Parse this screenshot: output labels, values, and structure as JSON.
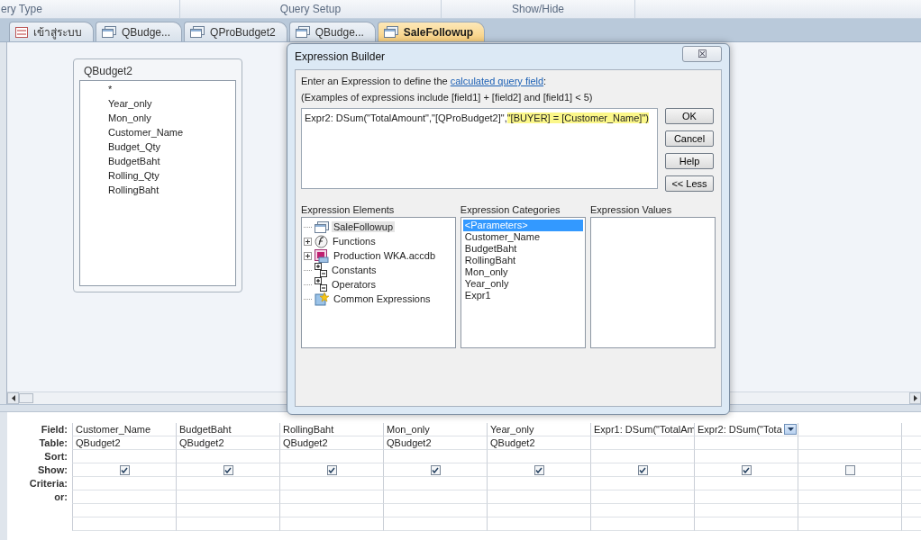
{
  "ribbon": {
    "groups": [
      "ery Type",
      "Query Setup",
      "Show/Hide"
    ]
  },
  "tabs": [
    {
      "label": "เข้าสู่ระบบ",
      "kind": "form",
      "selected": false
    },
    {
      "label": "QBudge...",
      "kind": "query",
      "selected": false
    },
    {
      "label": "QProBudget2",
      "kind": "query",
      "selected": false
    },
    {
      "label": "QBudge...",
      "kind": "query",
      "selected": false
    },
    {
      "label": "SaleFollowup",
      "kind": "query",
      "selected": true
    }
  ],
  "table_box": {
    "title": "QBudget2",
    "fields": [
      "*",
      "Year_only",
      "Mon_only",
      "Customer_Name",
      "Budget_Qty",
      "BudgetBaht",
      "Rolling_Qty",
      "RollingBaht"
    ]
  },
  "dialog": {
    "title": "Expression Builder",
    "close": "☒",
    "intro": "Enter an Expression to define the ",
    "link": "calculated query field",
    "intro_end": ":",
    "examples": "(Examples of expressions include [field1] + [field2] and [field1] < 5)",
    "expression": [
      {
        "text": "Expr2: DSum(\"TotalAmount\",\"[QProBudget2]\",",
        "highlighted": false
      },
      {
        "text": "\"[BUYER] = [Customer_Name]\")",
        "highlighted": true
      }
    ],
    "buttons": [
      "OK",
      "Cancel",
      "Help",
      "<< Less"
    ],
    "elements_label": "Expression Elements",
    "categories_label": "Expression Categories",
    "values_label": "Expression Values",
    "elements": [
      {
        "label": "SaleFollowup",
        "kind": "table",
        "expandable": false,
        "selected": true
      },
      {
        "label": "Functions",
        "kind": "function",
        "expandable": true,
        "selected": false
      },
      {
        "label": "Production WKA.accdb",
        "kind": "database",
        "expandable": true,
        "selected": false
      },
      {
        "label": "Constants",
        "kind": "constants",
        "expandable": false,
        "selected": false
      },
      {
        "label": "Operators",
        "kind": "constants",
        "expandable": false,
        "selected": false
      },
      {
        "label": "Common Expressions",
        "kind": "common",
        "expandable": false,
        "selected": false
      }
    ],
    "categories": [
      {
        "label": "<Parameters>",
        "selected": true
      },
      {
        "label": "Customer_Name",
        "selected": false
      },
      {
        "label": "BudgetBaht",
        "selected": false
      },
      {
        "label": "RollingBaht",
        "selected": false
      },
      {
        "label": "Mon_only",
        "selected": false
      },
      {
        "label": "Year_only",
        "selected": false
      },
      {
        "label": "Expr1",
        "selected": false
      }
    ]
  },
  "grid": {
    "row_labels": [
      "Field:",
      "Table:",
      "Sort:",
      "Show:",
      "Criteria:",
      "or:"
    ],
    "columns": [
      {
        "field": "Customer_Name",
        "table": "QBudget2",
        "show": true,
        "selected": false
      },
      {
        "field": "BudgetBaht",
        "table": "QBudget2",
        "show": true,
        "selected": false
      },
      {
        "field": "RollingBaht",
        "table": "QBudget2",
        "show": true,
        "selected": false
      },
      {
        "field": "Mon_only",
        "table": "QBudget2",
        "show": true,
        "selected": false
      },
      {
        "field": "Year_only",
        "table": "QBudget2",
        "show": true,
        "selected": false
      },
      {
        "field": "Expr1: DSum(\"TotalAm",
        "show": true,
        "selected": false
      },
      {
        "field": "Expr2: DSum(\"Tota",
        "show": true,
        "selected": true
      },
      {
        "show": false,
        "selected": false
      }
    ]
  }
}
